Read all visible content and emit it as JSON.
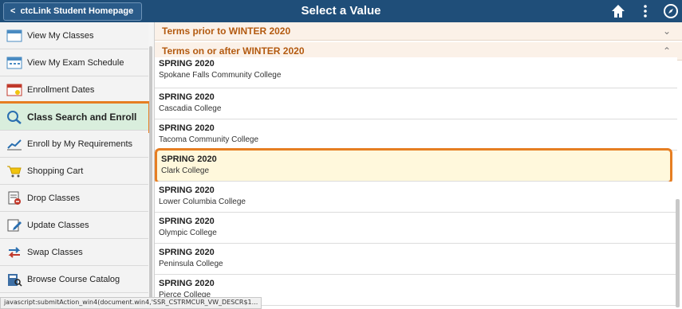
{
  "topbar": {
    "home_label": "ctcLink Student Homepage",
    "title": "Select a Value",
    "icons": [
      "home-icon",
      "more-vert-icon",
      "navbar-icon"
    ],
    "color": "#1f4e79"
  },
  "sidebar": {
    "items": [
      {
        "label": "View My Classes",
        "icon": "calendar-icon"
      },
      {
        "label": "View My Exam Schedule",
        "icon": "exam-schedule-icon"
      },
      {
        "label": "Enrollment Dates",
        "icon": "enrollment-calendar-icon"
      },
      {
        "label": "Class Search and Enroll",
        "icon": "search-icon",
        "active": true
      },
      {
        "label": "Enroll by My Requirements",
        "icon": "chart-icon"
      },
      {
        "label": "Shopping Cart",
        "icon": "cart-icon"
      },
      {
        "label": "Drop Classes",
        "icon": "drop-icon"
      },
      {
        "label": "Update Classes",
        "icon": "edit-icon"
      },
      {
        "label": "Swap Classes",
        "icon": "swap-icon"
      },
      {
        "label": "Browse Course Catalog",
        "icon": "catalog-icon"
      }
    ]
  },
  "main": {
    "groups": [
      {
        "label": "Terms prior to WINTER 2020",
        "chevron": "chevron-down-icon"
      },
      {
        "label": "Terms on or after WINTER 2020",
        "chevron": "chevron-up-icon"
      }
    ],
    "rows": [
      {
        "term": "SPRING 2020",
        "college": "Spokane Falls Community College"
      },
      {
        "term": "SPRING 2020",
        "college": "Cascadia College"
      },
      {
        "term": "SPRING 2020",
        "college": "Tacoma Community College"
      },
      {
        "term": "SPRING 2020",
        "college": "Clark College",
        "selected": true
      },
      {
        "term": "SPRING 2020",
        "college": "Lower Columbia College"
      },
      {
        "term": "SPRING 2020",
        "college": "Olympic College"
      },
      {
        "term": "SPRING 2020",
        "college": "Peninsula College"
      },
      {
        "term": "SPRING 2020",
        "college": "Pierce College"
      }
    ]
  },
  "status_bar": "javascript:submitAction_win4(document.win4,'SSR_CSTRMCUR_VW_DESCR$1..."
}
